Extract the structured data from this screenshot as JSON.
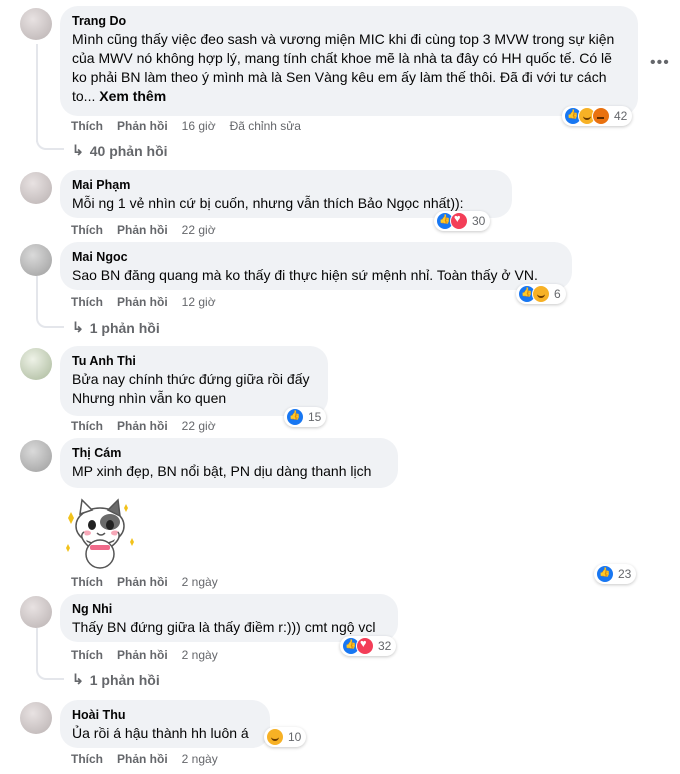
{
  "comments": [
    {
      "name": "Trang Do",
      "text": "Mình cũng thấy việc đeo sash và vương miện MIC khi đi cùng top 3 MVW trong sự kiện của MWV nó không hợp lý, mang tính chất khoe mẽ là nhà ta đây có HH quốc tế. Có lẽ ko phải BN làm theo ý mình mà là Sen Vàng kêu em ấy làm thế thôi. Đã đi với tư cách to...",
      "see_more": "Xem thêm",
      "like": "Thích",
      "reply": "Phản hồi",
      "time": "16 giờ",
      "edited": "Đã chỉnh sửa",
      "reaction_count": "42",
      "replies": "40 phản hồi"
    },
    {
      "name": "Mai Phạm",
      "text": "Mỗi ng 1 vẻ nhìn cứ bị cuốn, nhưng vẫn thích Bảo Ngọc nhất)):",
      "like": "Thích",
      "reply": "Phản hồi",
      "time": "22 giờ",
      "reaction_count": "30"
    },
    {
      "name": "Mai Ngoc",
      "text": "Sao BN đăng quang mà ko thấy đi thực hiện sứ mệnh nhỉ. Toàn thấy ở VN.",
      "like": "Thích",
      "reply": "Phản hồi",
      "time": "12 giờ",
      "reaction_count": "6",
      "replies": "1 phản hồi"
    },
    {
      "name": "Tu Anh Thi",
      "text_line1": "Bửa nay chính thức đứng giữa rồi đấy",
      "text_line2": "Nhưng nhìn vẫn ko quen",
      "like": "Thích",
      "reply": "Phản hồi",
      "time": "22 giờ",
      "reaction_count": "15"
    },
    {
      "name": "Thị Cám",
      "text": "MP xinh đẹp, BN nổi bật, PN dịu dàng thanh lịch",
      "like": "Thích",
      "reply": "Phản hồi",
      "time": "2 ngày",
      "reaction_count": "23"
    },
    {
      "name": "Ng Nhi",
      "text": "Thấy BN đứng giữa là thấy điềm r:))) cmt ngộ vcl",
      "like": "Thích",
      "reply": "Phản hồi",
      "time": "2 ngày",
      "reaction_count": "32",
      "replies": "1 phản hồi"
    },
    {
      "name": "Hoài Thu",
      "text": "Ủa rồi á hậu thành hh luôn á",
      "like": "Thích",
      "reply": "Phản hồi",
      "time": "2 ngày",
      "reaction_count": "10"
    }
  ],
  "icons": {
    "more": "more-horizontal-icon",
    "reply_arrow": "reply-arrow-icon"
  },
  "colors": {
    "bubble": "#f0f2f5",
    "muted": "#65676b",
    "like": "#1877f2",
    "love": "#f33e58",
    "haha": "#f7b125"
  }
}
